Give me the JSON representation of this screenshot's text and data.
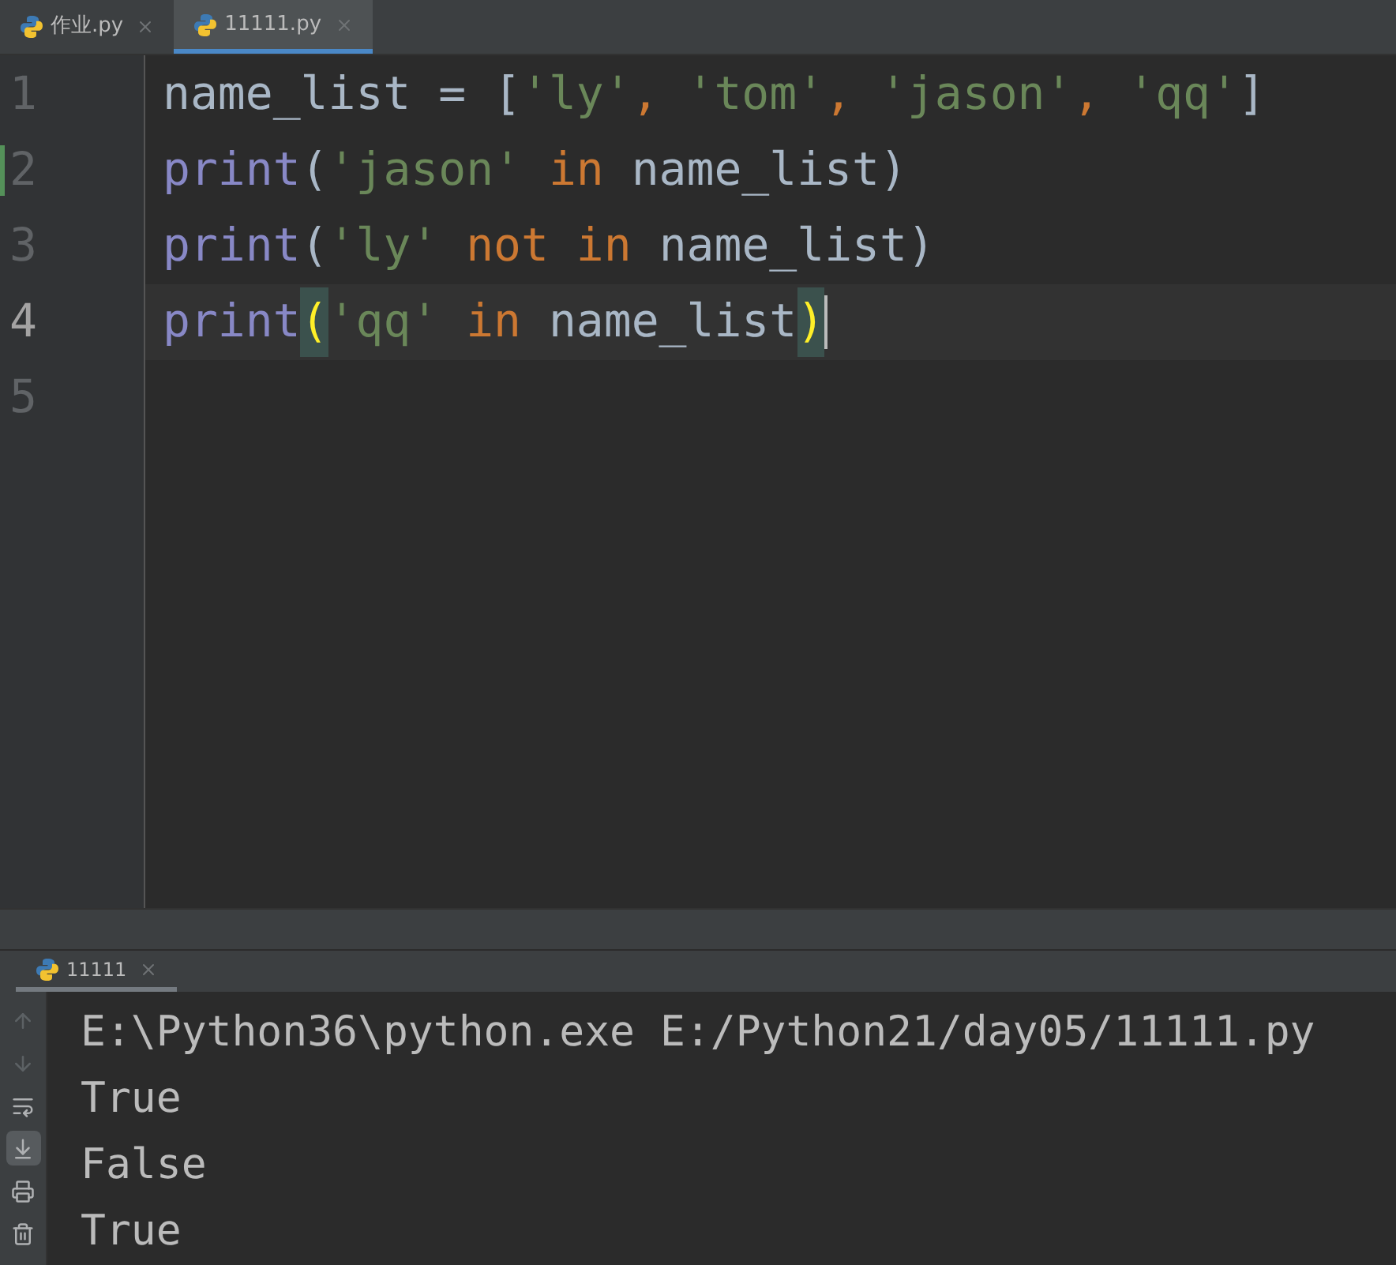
{
  "tabs": [
    {
      "label": "作业.py",
      "selected": false
    },
    {
      "label": "11111.py",
      "selected": true
    }
  ],
  "editor": {
    "lines": [
      {
        "number": "1",
        "current": false,
        "modified": false,
        "tokens": [
          {
            "text": "name_list = [",
            "kind": "plain"
          },
          {
            "text": "'ly'",
            "kind": "string"
          },
          {
            "text": ", ",
            "kind": "keyword"
          },
          {
            "text": "'tom'",
            "kind": "string"
          },
          {
            "text": ", ",
            "kind": "keyword"
          },
          {
            "text": "'jason'",
            "kind": "string"
          },
          {
            "text": ", ",
            "kind": "keyword"
          },
          {
            "text": "'qq'",
            "kind": "string"
          },
          {
            "text": "]",
            "kind": "plain"
          }
        ]
      },
      {
        "number": "2",
        "current": false,
        "modified": true,
        "tokens": [
          {
            "text": "print",
            "kind": "builtin"
          },
          {
            "text": "(",
            "kind": "plain"
          },
          {
            "text": "'jason'",
            "kind": "string"
          },
          {
            "text": " in ",
            "kind": "keyword"
          },
          {
            "text": "name_list)",
            "kind": "plain"
          }
        ]
      },
      {
        "number": "3",
        "current": false,
        "modified": false,
        "tokens": [
          {
            "text": "print",
            "kind": "builtin"
          },
          {
            "text": "(",
            "kind": "plain"
          },
          {
            "text": "'ly'",
            "kind": "string"
          },
          {
            "text": " not in ",
            "kind": "keyword"
          },
          {
            "text": "name_list)",
            "kind": "plain"
          }
        ]
      },
      {
        "number": "4",
        "current": true,
        "modified": false,
        "tokens": [
          {
            "text": "print",
            "kind": "builtin"
          },
          {
            "text": "(",
            "kind": "match"
          },
          {
            "text": "'qq'",
            "kind": "string"
          },
          {
            "text": " in ",
            "kind": "keyword"
          },
          {
            "text": "name_list",
            "kind": "plain"
          },
          {
            "text": ")",
            "kind": "match"
          }
        ]
      },
      {
        "number": "5",
        "current": false,
        "modified": false
      }
    ]
  },
  "run_panel": {
    "tab": {
      "label": "11111",
      "selected": true
    },
    "toolbar": [
      {
        "kind": "up",
        "disabled": true,
        "selected": false
      },
      {
        "kind": "down",
        "disabled": true,
        "selected": false
      },
      {
        "kind": "wrap",
        "disabled": false,
        "selected": false
      },
      {
        "kind": "scroll",
        "disabled": false,
        "selected": true
      },
      {
        "kind": "print",
        "disabled": false,
        "selected": false
      },
      {
        "kind": "trash",
        "disabled": false,
        "selected": false
      }
    ],
    "output": [
      "E:\\Python36\\python.exe E:/Python21/day05/11111.py",
      "True",
      "False",
      "True"
    ]
  }
}
